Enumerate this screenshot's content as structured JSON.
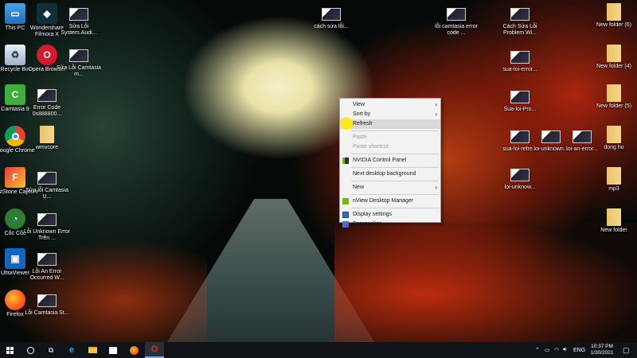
{
  "desktop_left": [
    {
      "label": "This PC",
      "icon": "this-pc-icon"
    },
    {
      "label": "Recycle Bin",
      "icon": "recycle-bin-icon"
    },
    {
      "label": "Camtasia 9",
      "icon": "camtasia-icon"
    },
    {
      "label": "Google Chrome",
      "icon": "chrome-icon"
    },
    {
      "label": "FastStone Capture",
      "icon": "faststone-icon"
    },
    {
      "label": "Cốc Cốc",
      "icon": "coccoc-icon"
    },
    {
      "label": "UltraViewer",
      "icon": "ultraviewer-icon"
    },
    {
      "label": "Firefox",
      "icon": "firefox-icon"
    }
  ],
  "desktop_col2": [
    {
      "label": "Wondershare Filmora X",
      "icon": "filmora-icon"
    },
    {
      "label": "Opera Browser",
      "icon": "opera-icon"
    },
    {
      "label": "Error Code 0x888800...",
      "icon": "thumbnail-icon"
    },
    {
      "label": "wmvcore",
      "icon": "file-icon"
    },
    {
      "label": "Sửa lỗi Camtasia U...",
      "icon": "thumbnail-icon"
    },
    {
      "label": "Lỗi Unknown Error Trên ...",
      "icon": "thumbnail-icon"
    },
    {
      "label": "Lỗi An Error Occurred W...",
      "icon": "thumbnail-icon"
    },
    {
      "label": "Lỗi Camtasia St...",
      "icon": "thumbnail-icon"
    }
  ],
  "desktop_col3": [
    {
      "label": "Sửa Lỗi System.Audi...",
      "icon": "thumbnail-icon"
    },
    {
      "label": "Sửa Lỗi Camtasia m...",
      "icon": "thumbnail-icon"
    }
  ],
  "desktop_top_mid": {
    "label": "cách sửa lỗi...",
    "icon": "thumbnail-icon"
  },
  "desktop_right_a": [
    {
      "label": "lỗi camtasia error code ...",
      "icon": "thumbnail-icon"
    }
  ],
  "desktop_right_b": [
    {
      "label": "Cách Sửa Lỗi Problem Wi...",
      "icon": "thumbnail-icon"
    },
    {
      "label": "sua-loi-error...",
      "icon": "thumbnail-icon"
    },
    {
      "label": "Sua-loi-Pro...",
      "icon": "thumbnail-icon"
    },
    {
      "label": "loi-unknow...",
      "icon": "thumbnail-icon"
    }
  ],
  "desktop_right_row": [
    {
      "label": "sua-loi-refre...",
      "icon": "thumbnail-icon"
    },
    {
      "label": "loi-unknown...",
      "icon": "thumbnail-icon"
    },
    {
      "label": "loi-an-error...",
      "icon": "thumbnail-icon"
    }
  ],
  "desktop_far_right": [
    {
      "label": "New folder (6)",
      "icon": "folder-icon"
    },
    {
      "label": "New folder (4)",
      "icon": "folder-icon"
    },
    {
      "label": "New folder (5)",
      "icon": "folder-icon"
    },
    {
      "label": "dong ho",
      "icon": "folder-icon"
    },
    {
      "label": "mp3",
      "icon": "folder-icon"
    },
    {
      "label": "New folder",
      "icon": "folder-icon"
    }
  ],
  "context_menu": {
    "view": "View",
    "sort_by": "Sort by",
    "refresh": "Refresh",
    "paste": "Paste",
    "paste_shortcut": "Paste shortcut",
    "nvidia": "NVIDIA Control Panel",
    "next_bg": "Next desktop background",
    "new": "New",
    "nview": "nView Desktop Manager",
    "display": "Display settings",
    "personalize": "Personalize"
  },
  "taskbar": {
    "lang": "ENG",
    "time": "10:37 PM",
    "date": "1/30/2021"
  },
  "colors": {
    "taskbar": "#101418",
    "menu_bg": "#f2f2f2",
    "highlight": "#d9d9d9"
  }
}
